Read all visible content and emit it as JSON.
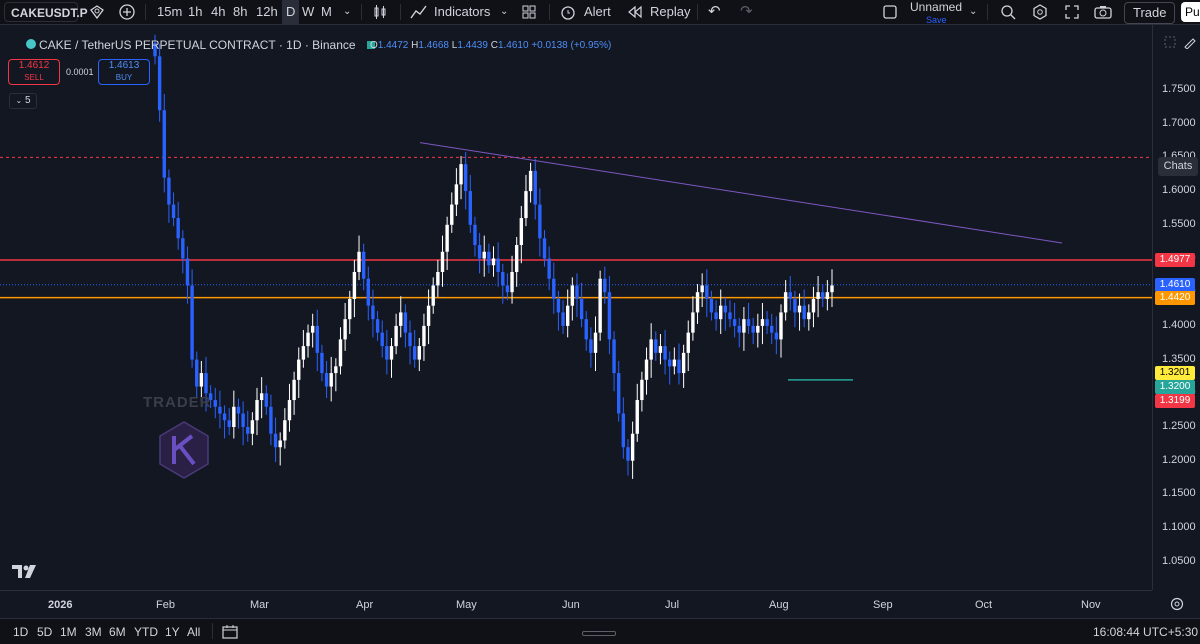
{
  "toolbar": {
    "symbol": "CAKEUSDT.P",
    "intervals": [
      "15m",
      "1h",
      "4h",
      "8h",
      "12h",
      "D",
      "W",
      "M"
    ],
    "indicators_label": "Indicators",
    "alert_label": "Alert",
    "replay_label": "Replay",
    "layout_name": "Unnamed",
    "save_label": "Save",
    "trade_label": "Trade",
    "publish_label": "Pu"
  },
  "legend": {
    "title": "CAKE / TetherUS PERPETUAL CONTRACT · 1D · Binance",
    "o_label": "O",
    "o": "1.4472",
    "h_label": "H",
    "h": "1.4668",
    "l_label": "L",
    "l": "1.4439",
    "c_label": "C",
    "c": "1.4610",
    "change": "+0.0138 (+0.95%)",
    "sell_price": "1.4612",
    "sell_label": "SELL",
    "spread": "0.0001",
    "buy_price": "1.4613",
    "buy_label": "BUY",
    "indicator_count": "5"
  },
  "watermark": "TRADER",
  "chats_label": "Chats",
  "price_tags": [
    {
      "value": "1.4977",
      "color": "#f23645"
    },
    {
      "value": "1.4610",
      "color": "#2962ff"
    },
    {
      "value": "1.4420",
      "color": "#ff9800"
    },
    {
      "value": "1.3201",
      "color": "#ffeb3b"
    },
    {
      "value": "1.3200",
      "color": "#26a69a"
    },
    {
      "value": "1.3199",
      "color": "#f23645"
    }
  ],
  "price_ticks": [
    "1.7500",
    "1.7000",
    "1.6500",
    "1.6000",
    "1.5500",
    "1.5000",
    "1.4500",
    "1.4000",
    "1.3500",
    "1.3000",
    "1.2500",
    "1.2000",
    "1.1500",
    "1.1000",
    "1.0500"
  ],
  "time_ticks": [
    "2026",
    "Feb",
    "Mar",
    "Apr",
    "May",
    "Jun",
    "Jul",
    "Aug",
    "Sep",
    "Oct",
    "Nov"
  ],
  "ranges": [
    "1D",
    "5D",
    "1M",
    "3M",
    "6M",
    "YTD",
    "1Y",
    "All"
  ],
  "clock": "16:08:44 UTC+5:30",
  "colors": {
    "up": "#ffffff",
    "down": "#2962ff",
    "resistance": "#f23645",
    "support": "#ff9800",
    "trendline": "#7e57c2"
  },
  "chart_data": {
    "type": "candlestick",
    "title": "CAKE / TetherUS PERPETUAL CONTRACT · 1D · Binance",
    "ylim": [
      1.05,
      1.8
    ],
    "y_ticks": [
      1.75,
      1.7,
      1.65,
      1.6,
      1.55,
      1.5,
      1.45,
      1.4,
      1.35,
      1.3,
      1.25,
      1.2,
      1.15,
      1.1,
      1.05
    ],
    "x_ticks": [
      "2026",
      "Feb",
      "Mar",
      "Apr",
      "May",
      "Jun",
      "Jul",
      "Aug",
      "Sep",
      "Oct",
      "Nov"
    ],
    "horizontal_lines": [
      {
        "price": 1.4977,
        "color": "#f23645"
      },
      {
        "price": 1.442,
        "color": "#ff9800"
      },
      {
        "price": 1.461,
        "color": "#2962ff"
      },
      {
        "price": 1.65,
        "color": "#f23645",
        "style": "dashed"
      }
    ],
    "trendline": {
      "from": [
        "Apr",
        1.67
      ],
      "to": [
        "Sep",
        1.52
      ]
    },
    "closes": [
      1.8,
      1.72,
      1.62,
      1.58,
      1.56,
      1.53,
      1.5,
      1.46,
      1.35,
      1.31,
      1.33,
      1.3,
      1.29,
      1.28,
      1.27,
      1.26,
      1.25,
      1.28,
      1.27,
      1.25,
      1.24,
      1.26,
      1.29,
      1.3,
      1.28,
      1.24,
      1.22,
      1.23,
      1.26,
      1.29,
      1.32,
      1.35,
      1.37,
      1.39,
      1.4,
      1.36,
      1.33,
      1.31,
      1.33,
      1.34,
      1.38,
      1.41,
      1.44,
      1.48,
      1.51,
      1.47,
      1.43,
      1.41,
      1.39,
      1.37,
      1.35,
      1.37,
      1.4,
      1.42,
      1.39,
      1.37,
      1.35,
      1.37,
      1.4,
      1.43,
      1.46,
      1.48,
      1.51,
      1.55,
      1.58,
      1.61,
      1.64,
      1.6,
      1.55,
      1.52,
      1.5,
      1.51,
      1.49,
      1.5,
      1.48,
      1.46,
      1.45,
      1.48,
      1.52,
      1.56,
      1.6,
      1.63,
      1.58,
      1.53,
      1.5,
      1.47,
      1.44,
      1.42,
      1.4,
      1.43,
      1.46,
      1.44,
      1.41,
      1.38,
      1.36,
      1.39,
      1.47,
      1.45,
      1.38,
      1.33,
      1.27,
      1.22,
      1.2,
      1.24,
      1.29,
      1.32,
      1.35,
      1.38,
      1.36,
      1.37,
      1.35,
      1.34,
      1.35,
      1.33,
      1.36,
      1.39,
      1.42,
      1.45,
      1.46,
      1.44,
      1.42,
      1.41,
      1.43,
      1.42,
      1.41,
      1.4,
      1.39,
      1.41,
      1.4,
      1.39,
      1.4,
      1.41,
      1.4,
      1.39,
      1.38,
      1.42,
      1.45,
      1.44,
      1.42,
      1.43,
      1.41,
      1.42,
      1.44,
      1.45,
      1.44,
      1.45,
      1.46
    ]
  }
}
